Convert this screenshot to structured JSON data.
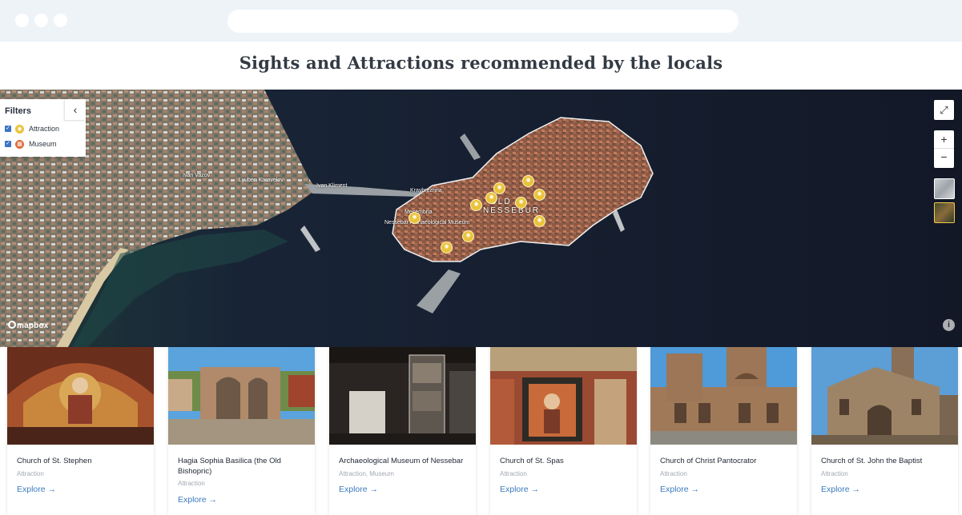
{
  "page": {
    "title": "Sights and Attractions recommended by the locals"
  },
  "filters": {
    "title": "Filters",
    "items": [
      {
        "label": "Attraction",
        "checked": true,
        "color": "#e9c33a",
        "icon": "camera-icon"
      },
      {
        "label": "Museum",
        "checked": true,
        "color": "#e26b3b",
        "icon": "museum-icon"
      }
    ]
  },
  "map": {
    "attribution": "mapbox",
    "labels": [
      "OLD",
      "NESSEBUR",
      "Ivan Vazov",
      "Lyuben Karavelov",
      "Ivan Kliment",
      "Mesembria",
      "Kraybrezhna",
      "Nessebar Archaeological Museum"
    ],
    "colors": {
      "water": "#141a2a",
      "marker": "#e9c33a"
    }
  },
  "cards": [
    {
      "title": "Church of St. Stephen",
      "category": "Attraction",
      "cta": "Explore →"
    },
    {
      "title": "Hagia Sophia Basilica (the Old Bishopric)",
      "category": "Attraction",
      "cta": "Explore →"
    },
    {
      "title": "Archaeological Museum of Nessebar",
      "category": "Attraction, Museum",
      "cta": "Explore →"
    },
    {
      "title": "Church of St. Spas",
      "category": "Attraction",
      "cta": "Explore →"
    },
    {
      "title": "Church of Christ Pantocrator",
      "category": "Attraction",
      "cta": "Explore →"
    },
    {
      "title": "Church of St. John the Baptist",
      "category": "Attraction",
      "cta": "Explore →"
    }
  ]
}
